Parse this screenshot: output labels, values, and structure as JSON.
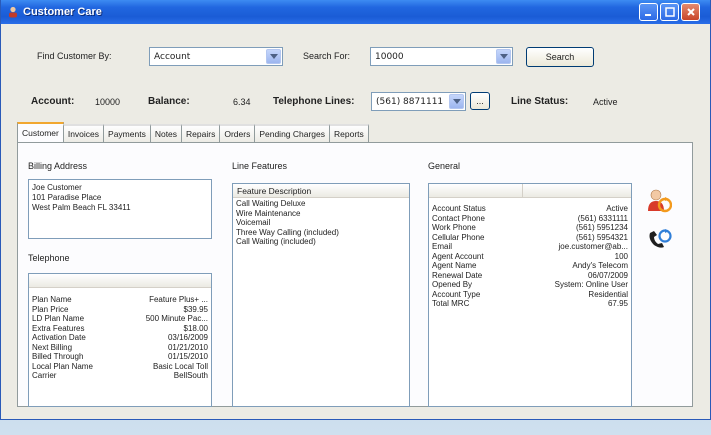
{
  "window": {
    "title": "Customer Care"
  },
  "search": {
    "find_by_label": "Find Customer By:",
    "find_by_value": "Account",
    "search_for_label": "Search For:",
    "search_for_value": "10000",
    "search_button": "Search"
  },
  "account": {
    "account_label": "Account:",
    "account_value": "10000",
    "balance_label": "Balance:",
    "balance_value": "6.34",
    "telephone_label": "Telephone Lines:",
    "telephone_value": "(561) 8871111",
    "more_button": "...",
    "status_label": "Line Status:",
    "status_value": "Active"
  },
  "tabs": [
    "Customer",
    "Invoices",
    "Payments",
    "Notes",
    "Repairs",
    "Orders",
    "Pending Charges",
    "Reports"
  ],
  "billing": {
    "title": "Billing Address",
    "line1": "Joe Customer",
    "line2": "101 Paradise Place",
    "line3": "West Palm Beach FL 33411"
  },
  "telephone": {
    "title": "Telephone",
    "rows": [
      {
        "k": "Plan Name",
        "v": "Feature Plus+ ..."
      },
      {
        "k": "Plan Price",
        "v": "$39.95"
      },
      {
        "k": "LD Plan Name",
        "v": "500 Minute Pac..."
      },
      {
        "k": "Extra Features",
        "v": "$18.00"
      },
      {
        "k": "Activation Date",
        "v": "03/16/2009"
      },
      {
        "k": "Next Billing",
        "v": "01/21/2010"
      },
      {
        "k": "Billed Through",
        "v": "01/15/2010"
      },
      {
        "k": "Local Plan Name",
        "v": "Basic Local Toll"
      },
      {
        "k": "Carrier",
        "v": "BellSouth"
      }
    ]
  },
  "line_features": {
    "title": "Line Features",
    "header": "Feature Description",
    "items": [
      "Call Waiting Deluxe",
      "Wire Maintenance",
      "Voicemail",
      "Three Way Calling (included)",
      "Call Waiting (included)"
    ]
  },
  "general": {
    "title": "General",
    "rows": [
      {
        "k": "Account Status",
        "v": "Active"
      },
      {
        "k": "Contact Phone",
        "v": "(561) 6331111"
      },
      {
        "k": "Work Phone",
        "v": "(561) 5951234"
      },
      {
        "k": "Cellular Phone",
        "v": "(561) 5954321"
      },
      {
        "k": "Email",
        "v": "joe.customer@ab..."
      },
      {
        "k": "Agent Account",
        "v": "100"
      },
      {
        "k": "Agent Name",
        "v": "Andy's Telecom"
      },
      {
        "k": "Renewal Date",
        "v": "06/07/2009"
      },
      {
        "k": "Opened By",
        "v": "System: Online User"
      },
      {
        "k": "Account Type",
        "v": "Residential"
      },
      {
        "k": "Total MRC",
        "v": "67.95"
      }
    ]
  },
  "icons": {
    "title": "user-icon",
    "side1": "user-refresh-icon",
    "side2": "phone-refresh-icon"
  }
}
